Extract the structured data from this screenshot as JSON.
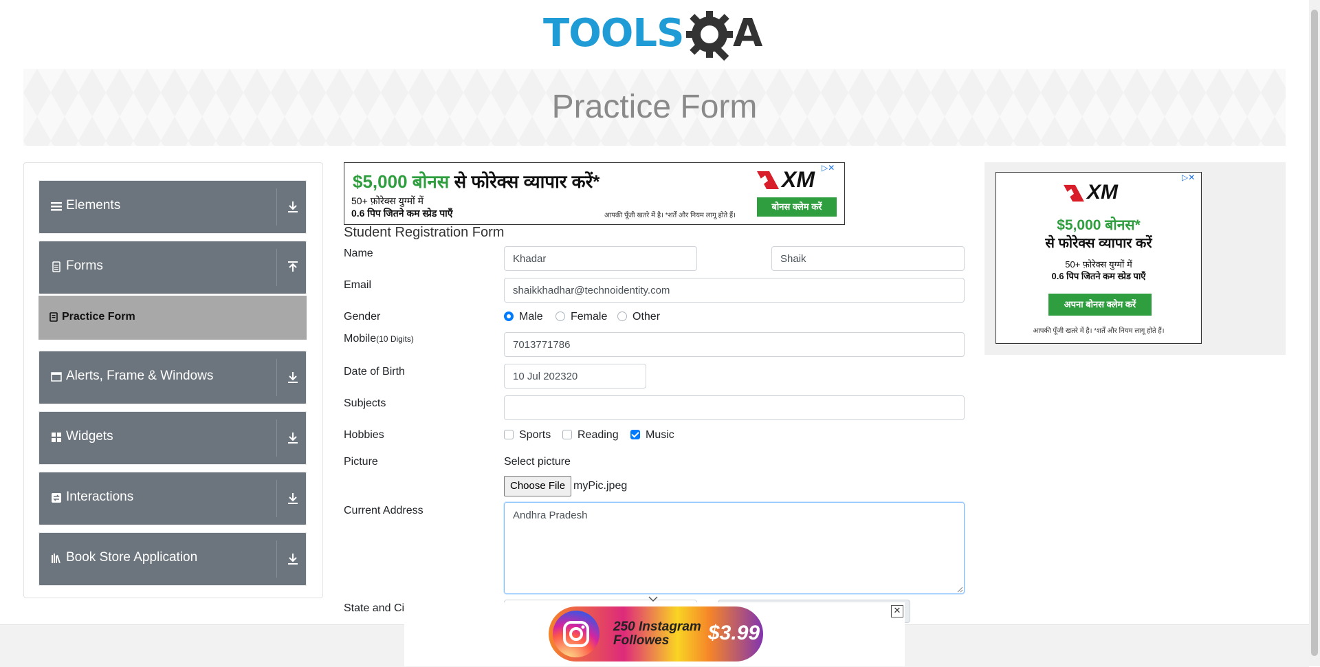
{
  "logo": {
    "text_left": "TOOLS",
    "text_right": "A"
  },
  "banner": {
    "title": "Practice Form"
  },
  "sidebar": {
    "groups": [
      {
        "label": "Elements",
        "icon": "hamburger-icon",
        "arrow": "download-arrow"
      },
      {
        "label": "Forms",
        "icon": "document-icon",
        "arrow": "upload-arrow"
      },
      {
        "label": "Alerts, Frame & Windows",
        "icon": "window-icon",
        "arrow": "download-arrow"
      },
      {
        "label": "Widgets",
        "icon": "grid-icon",
        "arrow": "download-arrow"
      },
      {
        "label": "Interactions",
        "icon": "swap-icon",
        "arrow": "download-arrow"
      },
      {
        "label": "Book Store Application",
        "icon": "books-icon",
        "arrow": "download-arrow"
      }
    ],
    "active_item": {
      "label": "Practice Form"
    }
  },
  "ads": {
    "top": {
      "headline_amount": "$5,000 बोनस",
      "headline_rest": " से फोरेक्स व्यापार करें*",
      "line1": "50+ फ़ोरेक्स युग्मों में",
      "line2": "0.6 पिप जितने कम स्प्रेड पाएँ",
      "disclaimer": "आपकी पूँजी खतरे में है। *शर्तें और नियम लागू होते हैं।",
      "button": "बोनस क्लेम करें",
      "brand": "XM",
      "adchoice": "▷✕"
    },
    "right": {
      "brand": "XM",
      "amount": "$5,000 बोनस*",
      "headline": "से फोरेक्स व्यापार करें",
      "line1": "50+ फ़ोरेक्स युग्मों में",
      "line2": "0.6 पिप जितने कम स्प्रेड पाएँ",
      "button": "अपना बोनस क्लेम करें",
      "disclaimer": "आपकी पूँजी खतरे में है। *शर्तें और नियम लागू होते हैं।",
      "adchoice": "▷✕"
    },
    "bottom": {
      "text": "250 Instagram Followes",
      "price": "$3.99",
      "close": "✕"
    }
  },
  "form": {
    "title": "Student Registration Form",
    "labels": {
      "name": "Name",
      "email": "Email",
      "gender": "Gender",
      "mobile": "Mobile",
      "mobile_hint": "(10 Digits)",
      "dob": "Date of Birth",
      "subjects": "Subjects",
      "hobbies": "Hobbies",
      "picture": "Picture",
      "address": "Current Address",
      "state_city": "State and City"
    },
    "first_name": "Khadar",
    "last_name": "Shaik",
    "email": "shaikkhadhar@technoidentity.com",
    "gender_options": [
      {
        "label": "Male",
        "checked": true
      },
      {
        "label": "Female",
        "checked": false
      },
      {
        "label": "Other",
        "checked": false
      }
    ],
    "mobile": "7013771786",
    "dob": "10 Jul 202320",
    "subjects": "",
    "hobbies": [
      {
        "label": "Sports",
        "checked": false
      },
      {
        "label": "Reading",
        "checked": false
      },
      {
        "label": "Music",
        "checked": true
      }
    ],
    "picture_label": "Select picture",
    "choose_file": "Choose File",
    "file_name": "myPic.jpeg",
    "address": "Andhra Pradesh"
  }
}
